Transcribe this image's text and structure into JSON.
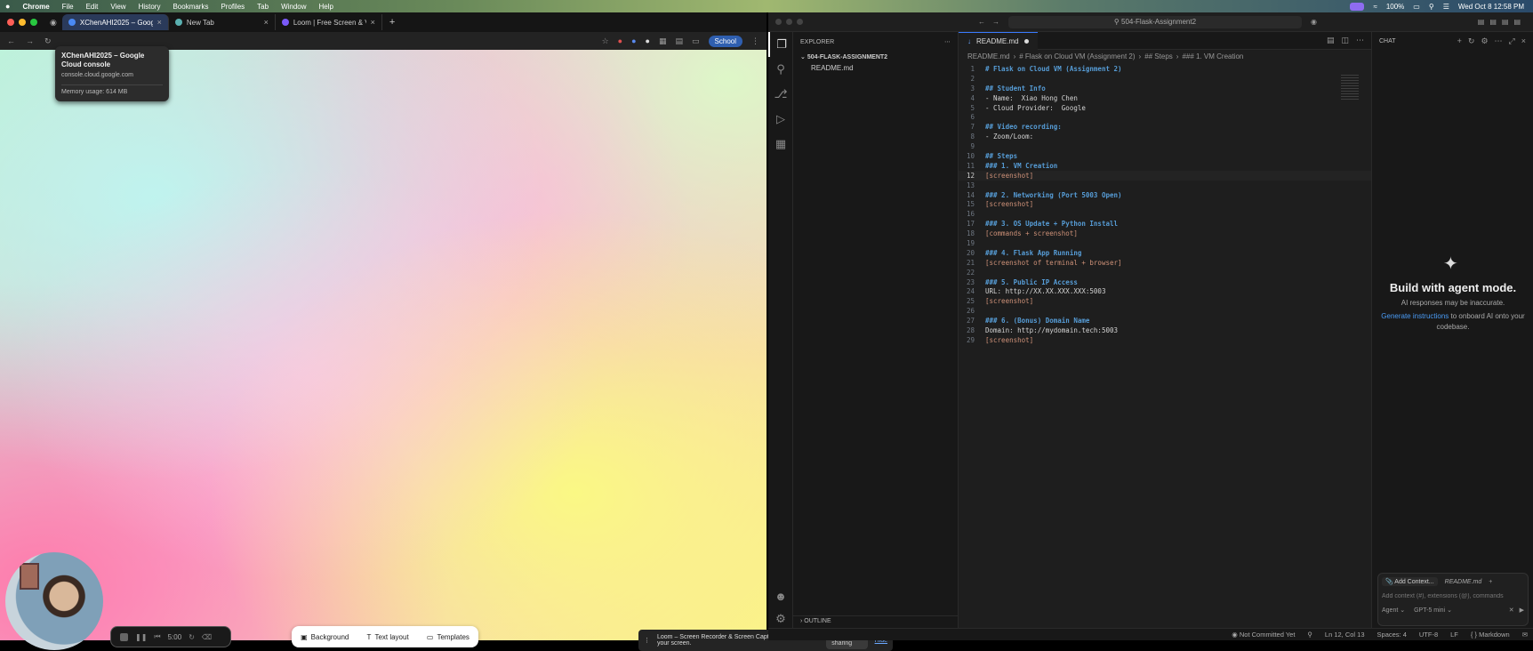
{
  "menubar": {
    "app": "Chrome",
    "items": [
      "File",
      "Edit",
      "View",
      "History",
      "Bookmarks",
      "Profiles",
      "Tab",
      "Window",
      "Help"
    ],
    "battery": "100%",
    "datetime": "Wed Oct 8  12:58 PM"
  },
  "chrome": {
    "tabs": [
      {
        "label": "XChenAHI2025 – Google Clo",
        "active": true
      },
      {
        "label": "New Tab",
        "active": false
      },
      {
        "label": "Loom | Free Screen & Vid",
        "active": false
      }
    ],
    "new_tab": "+",
    "profile": "School",
    "tooltip": {
      "title": "XChenAHI2025 – Google Cloud console",
      "url": "console.cloud.google.com",
      "memory": "Memory usage: 614 MB"
    },
    "recorder": {
      "time": "5:00"
    },
    "loom_tools": {
      "background": "Background",
      "text_layout": "Text layout",
      "templates": "Templates"
    },
    "share_bar": {
      "message": "Loom – Screen Recorder & Screen Capture is sharing your screen.",
      "stop": "Stop sharing",
      "hide": "Hide"
    }
  },
  "vscode": {
    "command_center": "504-Flask-Assignment2",
    "explorer": {
      "header": "EXPLORER",
      "folder": "504-FLASK-ASSIGNMENT2",
      "files": [
        "README.md"
      ],
      "outline": "OUTLINE"
    },
    "editor": {
      "tab": "README.md",
      "breadcrumb": [
        "README.md",
        "# Flask on Cloud VM (Assignment 2)",
        "## Steps",
        "### 1. VM Creation"
      ],
      "cursor_line": 12,
      "lines": [
        "# Flask on Cloud VM (Assignment 2)",
        "",
        "## Student Info",
        "- Name:  Xiao Hong Chen",
        "- Cloud Provider:  Google",
        "",
        "## Video recording:",
        "- Zoom/Loom:",
        "",
        "## Steps",
        "### 1. VM Creation",
        "[screenshot]",
        "",
        "### 2. Networking (Port 5003 Open)",
        "[screenshot]",
        "",
        "### 3. OS Update + Python Install",
        "[commands + screenshot]",
        "",
        "### 4. Flask App Running",
        "[screenshot of terminal + browser]",
        "",
        "### 5. Public IP Access",
        "URL: http://XX.XX.XXX.XXX:5003",
        "[screenshot]",
        "",
        "### 6. (Bonus) Domain Name",
        "Domain: http://mydomain.tech:5003",
        "[screenshot]"
      ]
    },
    "chat": {
      "header": "CHAT",
      "title": "Build with agent mode.",
      "subtitle": "AI responses may be inaccurate.",
      "link": "Generate instructions",
      "link_rest": " to onboard AI onto your codebase.",
      "add_context": "Add Context...",
      "context_file": "README.md",
      "placeholder": "Add context (#), extensions (@), commands",
      "mode": "Agent",
      "model": "GPT-5 mini"
    },
    "status": {
      "git": "Not Committed Yet",
      "position": "Ln 12, Col 13",
      "spaces": "Spaces: 4",
      "encoding": "UTF-8",
      "eol": "LF",
      "language": "Markdown"
    }
  }
}
